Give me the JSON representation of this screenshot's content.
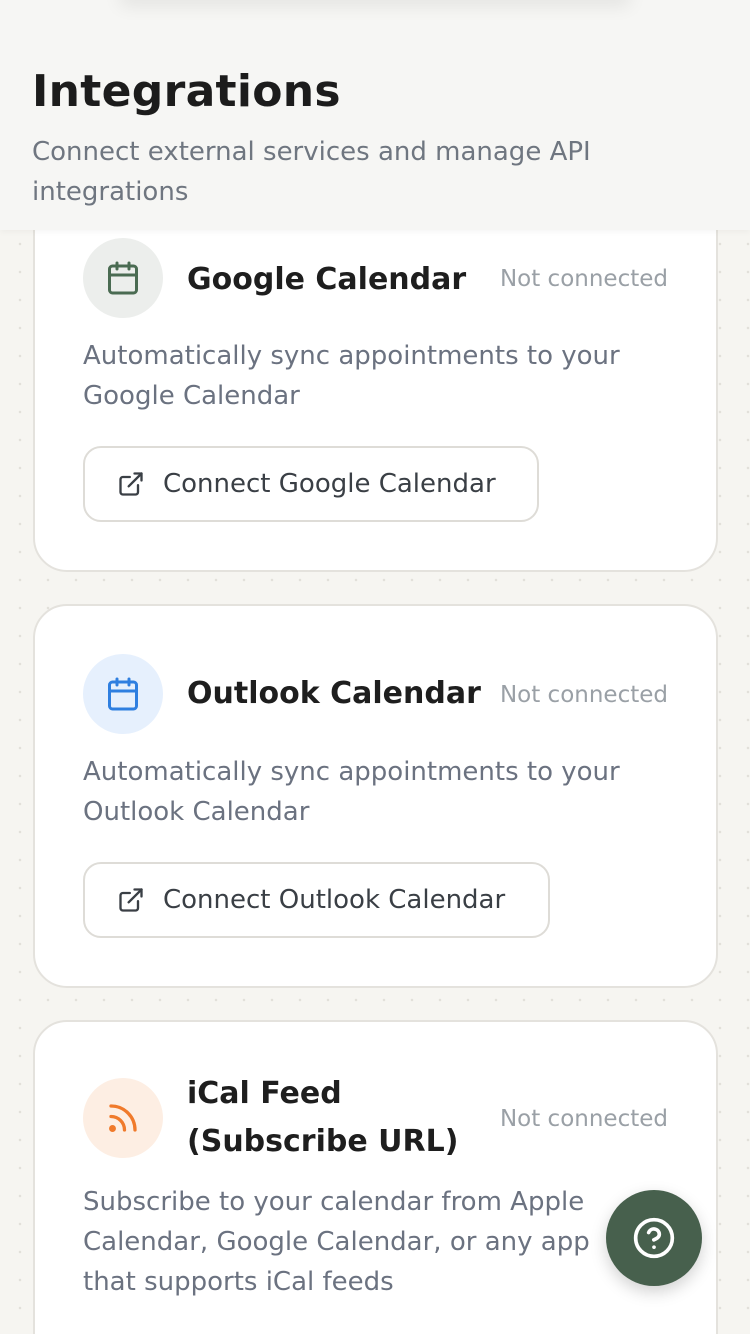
{
  "header": {
    "title": "Integrations",
    "subtitle": "Connect external services and manage API integrations"
  },
  "integrations": [
    {
      "name": "Google Calendar",
      "status": "Not connected",
      "description": "Automatically sync appointments to your Google Calendar",
      "button_label": "Connect Google Calendar",
      "icon": "calendar-icon",
      "icon_color": "#4a6b52"
    },
    {
      "name": "Outlook Calendar",
      "status": "Not connected",
      "description": "Automatically sync appointments to your Outlook Calendar",
      "button_label": "Connect Outlook Calendar",
      "icon": "calendar-icon",
      "icon_color": "#2f7fe0"
    },
    {
      "name": "iCal Feed (Subscribe URL)",
      "status": "Not connected",
      "description": "Subscribe to your calendar from Apple Calendar, Google Calendar, or any app that supports iCal feeds",
      "icon": "rss-icon",
      "icon_color": "#f07a2b"
    }
  ],
  "help": {
    "icon": "help-icon",
    "color": "#47604d"
  }
}
